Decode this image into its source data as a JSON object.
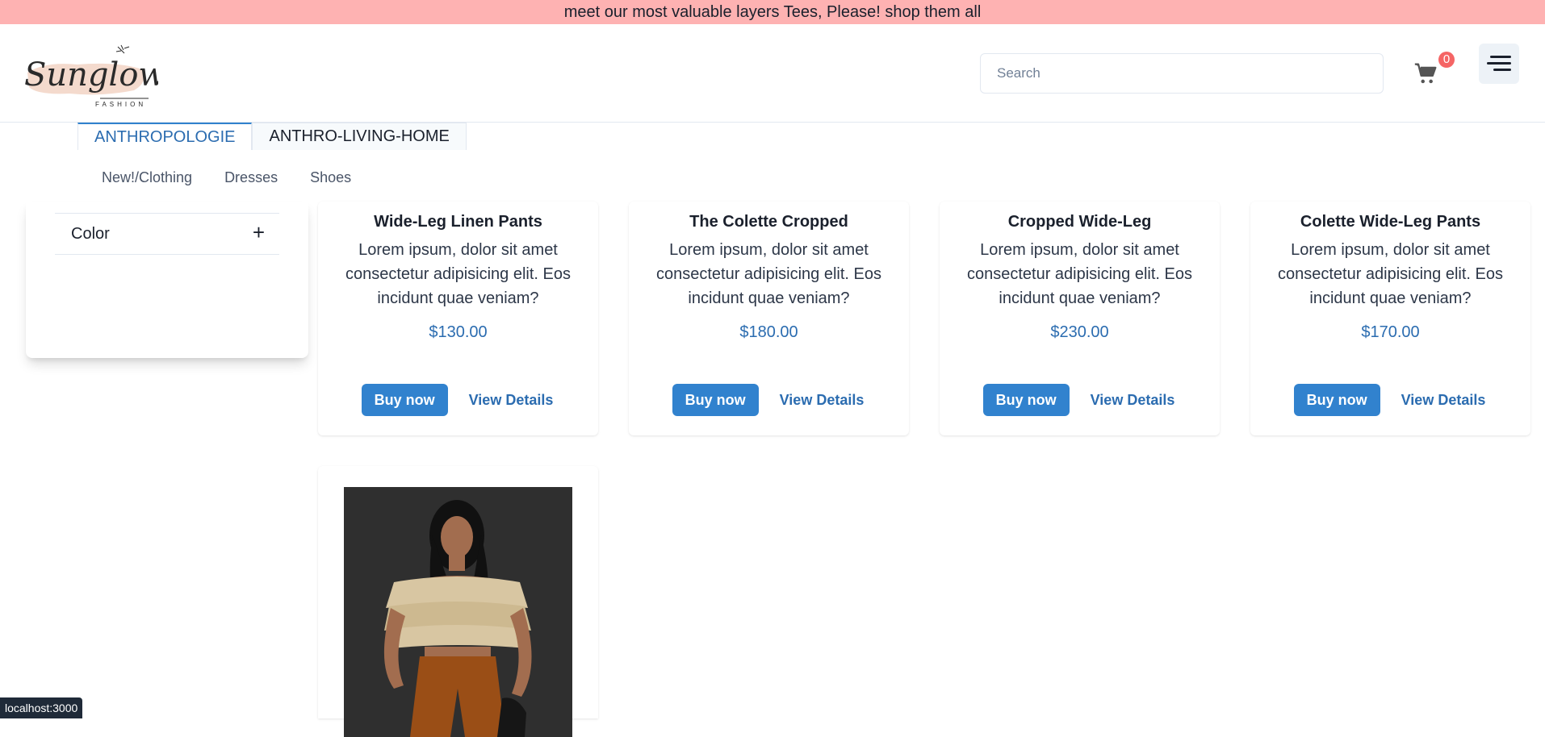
{
  "announcement": "meet our most valuable layers Tees, Please! shop them all",
  "header": {
    "logo_text": "Sunglow",
    "logo_sub": "FASHION",
    "search_placeholder": "Search",
    "cart_count": "0"
  },
  "tabs": [
    {
      "label": "ANTHROPOLOGIE",
      "active": true
    },
    {
      "label": "ANTHRO-LIVING-HOME",
      "active": false
    }
  ],
  "subnav": [
    "New!/Clothing",
    "Dresses",
    "Shoes"
  ],
  "filters": {
    "color_label": "Color",
    "expand_symbol": "+"
  },
  "products": [
    {
      "title": "Wide-Leg Linen Pants",
      "description": "Lorem ipsum, dolor sit amet consectetur adipisicing elit. Eos incidunt quae veniam?",
      "price": "$130.00",
      "buy_label": "Buy now",
      "details_label": "View Details"
    },
    {
      "title": "The Colette Cropped",
      "description": "Lorem ipsum, dolor sit amet consectetur adipisicing elit. Eos incidunt quae veniam?",
      "price": "$180.00",
      "buy_label": "Buy now",
      "details_label": "View Details"
    },
    {
      "title": "Cropped Wide-Leg",
      "description": "Lorem ipsum, dolor sit amet consectetur adipisicing elit. Eos incidunt quae veniam?",
      "price": "$230.00",
      "buy_label": "Buy now",
      "details_label": "View Details"
    },
    {
      "title": "Colette Wide-Leg Pants",
      "description": "Lorem ipsum, dolor sit amet consectetur adipisicing elit. Eos incidunt quae veniam?",
      "price": "$170.00",
      "buy_label": "Buy now",
      "details_label": "View Details"
    }
  ],
  "status_bar": "localhost:3000",
  "colors": {
    "announcement_bg": "#feb2b2",
    "primary": "#3182ce",
    "link": "#2b6cb0",
    "badge": "#f56565"
  }
}
